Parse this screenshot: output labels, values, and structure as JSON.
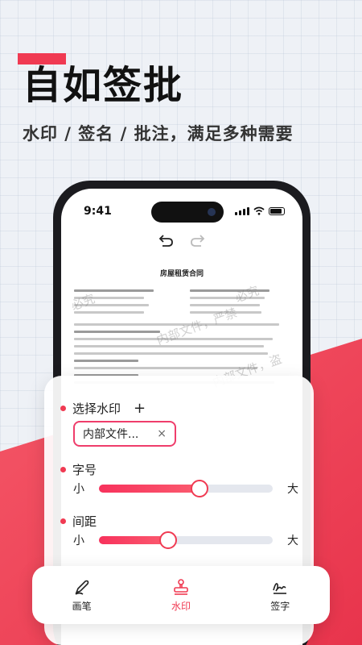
{
  "hero": {
    "title": "自如签批",
    "subtitle": "水印 / 签名 / 批注，满足多种需要"
  },
  "status_bar": {
    "time": "9:41"
  },
  "document": {
    "title": "房屋租赁合同",
    "watermarks": [
      "内部文件，严禁",
      "必究",
      "内部文件，盗",
      "内部文件，严",
      "必究"
    ]
  },
  "settings": {
    "watermark_label": "选择水印",
    "add_icon": "+",
    "selected_watermark": "内部文件...",
    "clear_icon": "×",
    "font_size_label": "字号",
    "spacing_label": "间距",
    "small": "小",
    "large": "大",
    "font_size_value_pct": 58,
    "spacing_value_pct": 40
  },
  "tabs": [
    {
      "label": "画笔",
      "icon": "pen-icon",
      "active": false
    },
    {
      "label": "水印",
      "icon": "stamp-icon",
      "active": true
    },
    {
      "label": "签字",
      "icon": "signature-icon",
      "active": false
    }
  ],
  "colors": {
    "accent": "#f03a52",
    "accent_gradient_end": "#fb5b6f"
  }
}
